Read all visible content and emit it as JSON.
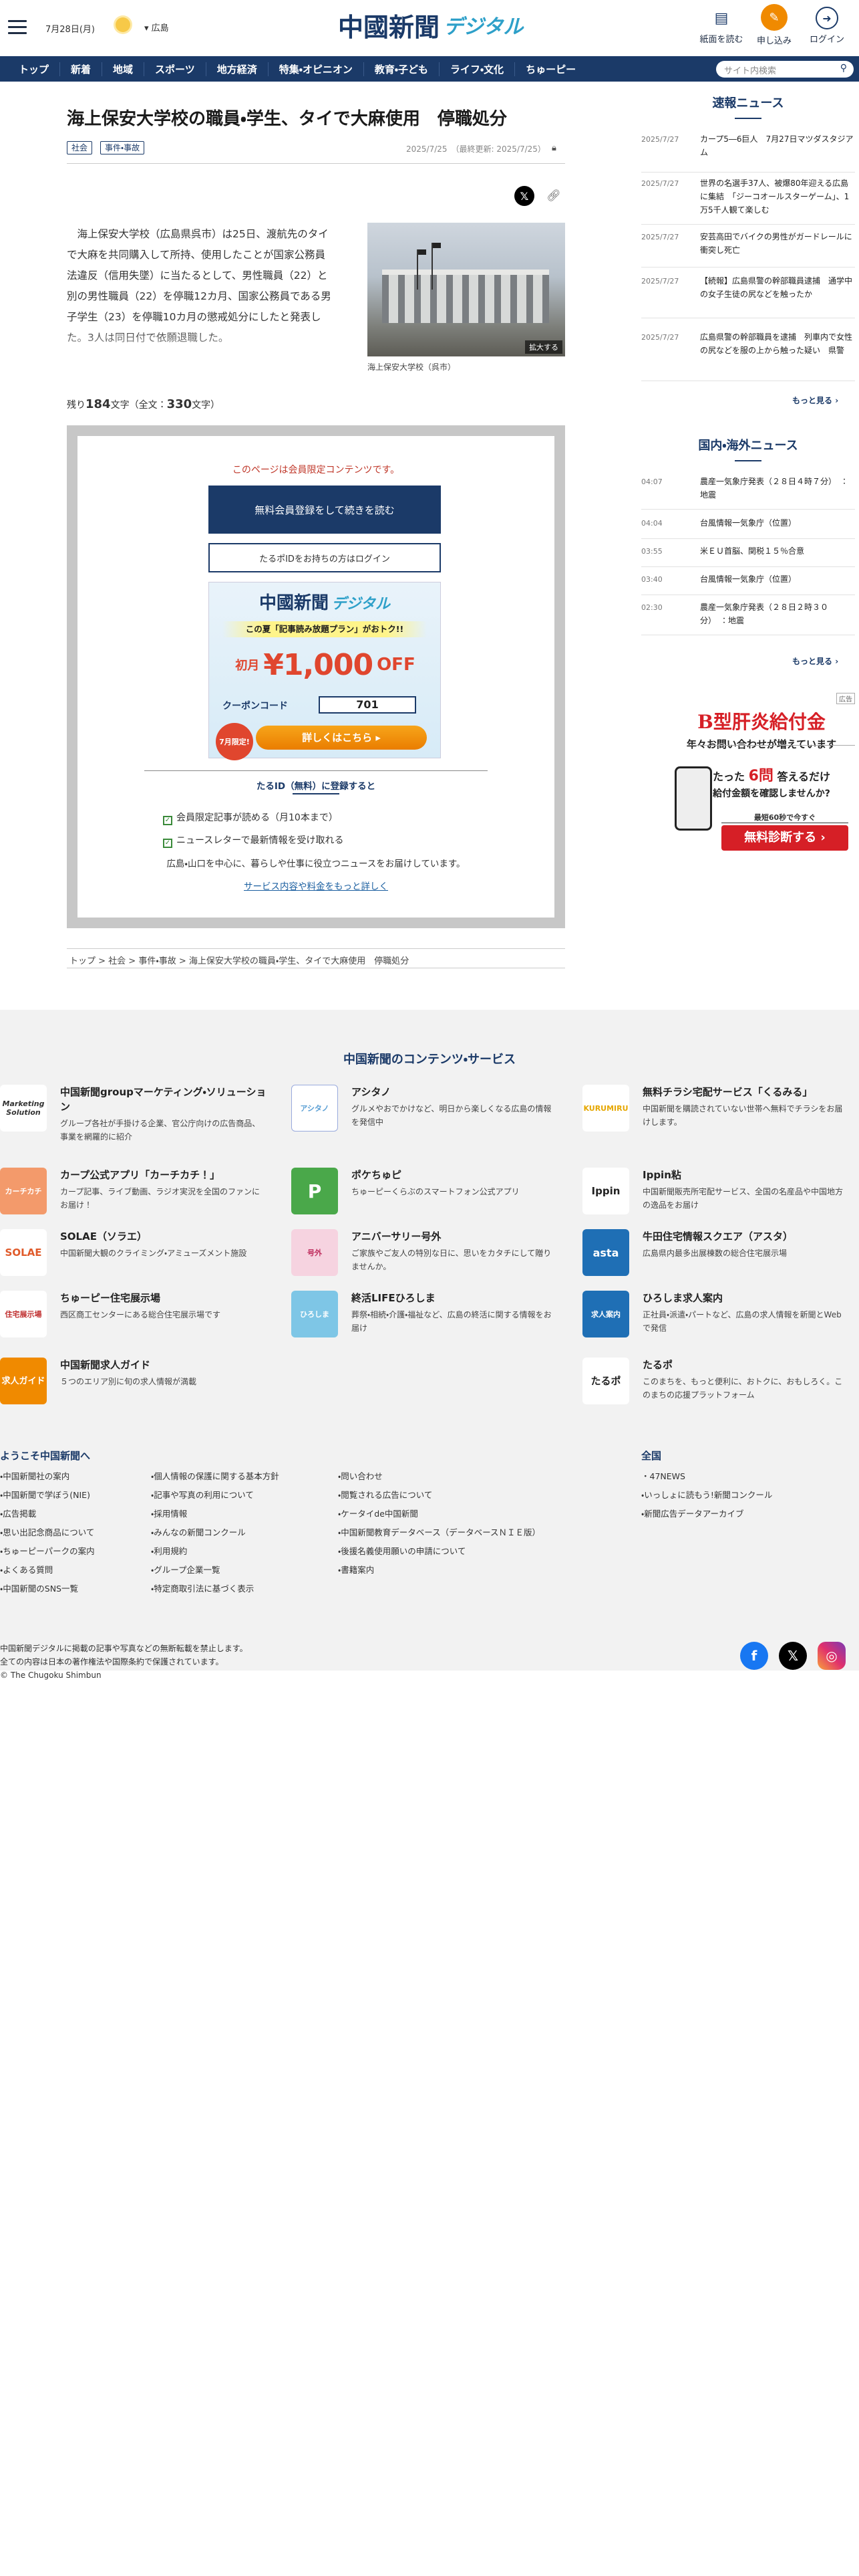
{
  "header": {
    "date": "7月28日(月)",
    "region": "広島",
    "logo_main": "中國新聞",
    "logo_sub": "デジタル",
    "icons": [
      {
        "label": "紙面を読む",
        "icon": "newspaper-icon"
      },
      {
        "label": "申し込み",
        "icon": "subscribe-icon"
      },
      {
        "label": "ログイン",
        "icon": "login-icon"
      }
    ]
  },
  "nav": {
    "items": [
      "トップ",
      "新着",
      "地域",
      "スポーツ",
      "地方経済",
      "特集・オピニオン",
      "教育・子ども",
      "ライフ・文化",
      "ちゅーピー"
    ],
    "search_placeholder": "サイト内検索"
  },
  "article": {
    "title": "海上保安大学校の職員・学生、タイで大麻使用　停職処分",
    "tags": [
      "社会",
      "事件・事故"
    ],
    "date": "2025/7/25",
    "updated": "（最終更新: 2025/7/25）",
    "body": "　海上保安大学校（広島県呉市）は25日、渡航先のタイで大麻を共同購入して所持、使用したことが国家公務員法違反（信用失墜）に当たるとして、男性職員（22）と別の男性職員（22）を停職12カ月、国家公務員である男子学生（23）を停職10カ月の懲戒処分にしたと発表した。3人は同日付で依願退職した。",
    "photo_caption": "海上保安大学校（呉市）",
    "photo_enlarge": "拡大する",
    "remaining_prefix": "残り",
    "remaining_count": "184",
    "remaining_mid": "文字（全文：",
    "total_count": "330",
    "remaining_suffix": "文字）"
  },
  "paywall": {
    "notice": "このページは会員限定コンテンツです。",
    "register_button": "無料会員登録をして続きを読む",
    "login_button": "たるポIDをお持ちの方はログイン",
    "promo": {
      "brand": "中國新聞",
      "brand_sub": "デジタル",
      "headline": "この夏「記事読み放題プラン」がおトク!!",
      "price_label": "初月",
      "price": "¥1,000",
      "off": "OFF",
      "coupon_label": "クーポンコード",
      "coupon_code": "701",
      "limited": "7月限定!",
      "cta": "詳しくはこちら"
    },
    "benefit_title": "たるID（無料）に登録すると",
    "benefits": [
      "会員限定記事が読める（月10本まで）",
      "ニュースレターで最新情報を受け取れる"
    ],
    "benefit_note": "広島・山口を中心に、暮らしや仕事に役立つニュースをお届けしています。",
    "more_link": "サービス内容や料金をもっと詳しく"
  },
  "breadcrumb": "トップ > 社会 > 事件・事故 > 海上保安大学校の職員・学生、タイで大麻使用　停職処分",
  "sidebar": {
    "breaking_title": "速報ニュース",
    "breaking": [
      {
        "date": "2025/7/27",
        "text": "カープ5―6巨人　7月27日マツダスタジアム"
      },
      {
        "date": "2025/7/27",
        "text": "世界の名選手37人、被爆80年迎える広島に集結　「ジーコオールスターゲーム」、1万5千人観て楽しむ"
      },
      {
        "date": "2025/7/27",
        "text": "安芸高田でバイクの男性がガードレールに衝突し死亡"
      },
      {
        "date": "2025/7/27",
        "text": "【続報】広島県警の幹部職員逮捕　通学中の女子生徒の尻などを触ったか"
      },
      {
        "date": "2025/7/27",
        "text": "広島県警の幹部職員を逮捕　列車内で女性の尻などを服の上から触った疑い　県警"
      }
    ],
    "breaking_more": "もっと見る",
    "world_title": "国内・海外ニュース",
    "world": [
      {
        "date": "04:07",
        "text": "農産一気象庁発表（２８日４時７分）　：地震"
      },
      {
        "date": "04:04",
        "text": "台風情報一気象庁（位置）"
      },
      {
        "date": "03:55",
        "text": "米ＥＵ首脳、関税１５％合意"
      },
      {
        "date": "03:40",
        "text": "台風情報一気象庁（位置）"
      },
      {
        "date": "02:30",
        "text": "農産一気象庁発表（２８日２時３０分）　：地震"
      }
    ],
    "world_more": "もっと見る",
    "ad": {
      "badge": "広告",
      "title": "B型肝炎給付金",
      "sub": "年々お問い合わせが増えています",
      "line1_a": "たった",
      "line1_b": "6問",
      "line1_c": "答えるだけ",
      "line2": "給付金額を確認しませんか?",
      "note": "最短60秒で今すぐ",
      "cta": "無料診断する"
    }
  },
  "footer": {
    "services_title": "中国新聞のコンテンツ・サービス",
    "services": [
      {
        "name": "中国新聞groupマーケティング・ソリューション",
        "desc": "グループ各社が手掛ける企業、官公庁向けの広告商品、事業を網羅的に紹介",
        "logo": "Marketing Solution"
      },
      {
        "name": "アシタノ",
        "desc": "グルメやおでかけなど、明日から楽しくなる広島の情報を発信中",
        "logo": "アシタノ"
      },
      {
        "name": "無料チラシ宅配サービス「くるみる」",
        "desc": "中国新聞を購読されていない世帯へ無料でチラシをお届けします。",
        "logo": "KURUMIRU"
      },
      {
        "name": "カープ公式アプリ「カーチカチ！」",
        "desc": "カープ記事、ライブ動画、ラジオ実況を全国のファンにお届け！",
        "logo": "カーチカチ"
      },
      {
        "name": "ポケちゅピ",
        "desc": "ちゅーピーくらぶのスマートフォン公式アプリ",
        "logo": "P"
      },
      {
        "name": "Ippin粘",
        "desc": "中国新聞販売所宅配サービス、全国の名産品や中国地方の逸品をお届け",
        "logo": "Ippin"
      },
      {
        "name": "SOLAE（ソラエ）",
        "desc": "中国新聞大観のクライミング・アミューズメント施設",
        "logo": "SOLAE"
      },
      {
        "name": "アニバーサリー号外",
        "desc": "ご家族やご友人の特別な日に、思いをカタチにして贈りませんか。",
        "logo": "号外"
      },
      {
        "name": "牛田住宅情報スクエア（アスタ）",
        "desc": "広島県内最多出展棟数の総合住宅展示場",
        "logo": "asta"
      },
      {
        "name": "ちゅーピー住宅展示場",
        "desc": "西区商工センターにある総合住宅展示場です",
        "logo": "住宅展示場"
      },
      {
        "name": "終活LIFEひろしま",
        "desc": "葬祭・相続・介護・福祉など、広島の終活に関する情報をお届け",
        "logo": "ひろしま"
      },
      {
        "name": "ひろしま求人案内",
        "desc": "正社員・派遣・パートなど、広島の求人情報を新聞とWebで発信",
        "logo": "求人案内"
      },
      {
        "name": "中国新聞求人ガイド",
        "desc": "５つのエリア別に旬の求人情報が満載",
        "logo": "求人ガイド"
      },
      {
        "name": "たるポ",
        "desc": "このまちを、もっと便利に、おトクに、おもしろく。このまちの応援プラットフォーム",
        "logo": "たるポ"
      }
    ],
    "welcome_title": "ようこそ中国新聞へ",
    "col1": [
      "中国新聞社の案内",
      "中国新聞で学ぼう(NIE)",
      "広告掲載",
      "思い出記念商品について",
      "ちゅーピーパークの案内",
      "よくある質問",
      "中国新聞のSNS一覧"
    ],
    "col2": [
      "個人情報の保護に関する基本方針",
      "記事や写真の利用について",
      "採用情報",
      "みんなの新聞コンクール",
      "利用規約",
      "グループ企業一覧",
      "特定商取引法に基づく表示"
    ],
    "col3": [
      "問い合わせ",
      "閲覧される広告について",
      "ケータイde中国新聞",
      "中国新聞教育データベース（データベースＮＩＥ版）",
      "後援名義使用願いの申請について",
      "書籍案内"
    ],
    "national_title": "全国",
    "col4": [
      "47NEWS",
      "いっしょに読もう!新聞コンクール",
      "新聞広告データアーカイブ"
    ],
    "copyright": [
      "中国新聞デジタルに掲載の記事や写真などの無断転載を禁止します。",
      "全ての内容は日本の著作権法や国際条約で保護されています。",
      "© The Chugoku Shimbun"
    ]
  },
  "colors": {
    "navy": "#1b3a68",
    "accent_red": "#c0392b",
    "orange": "#f08a00"
  }
}
